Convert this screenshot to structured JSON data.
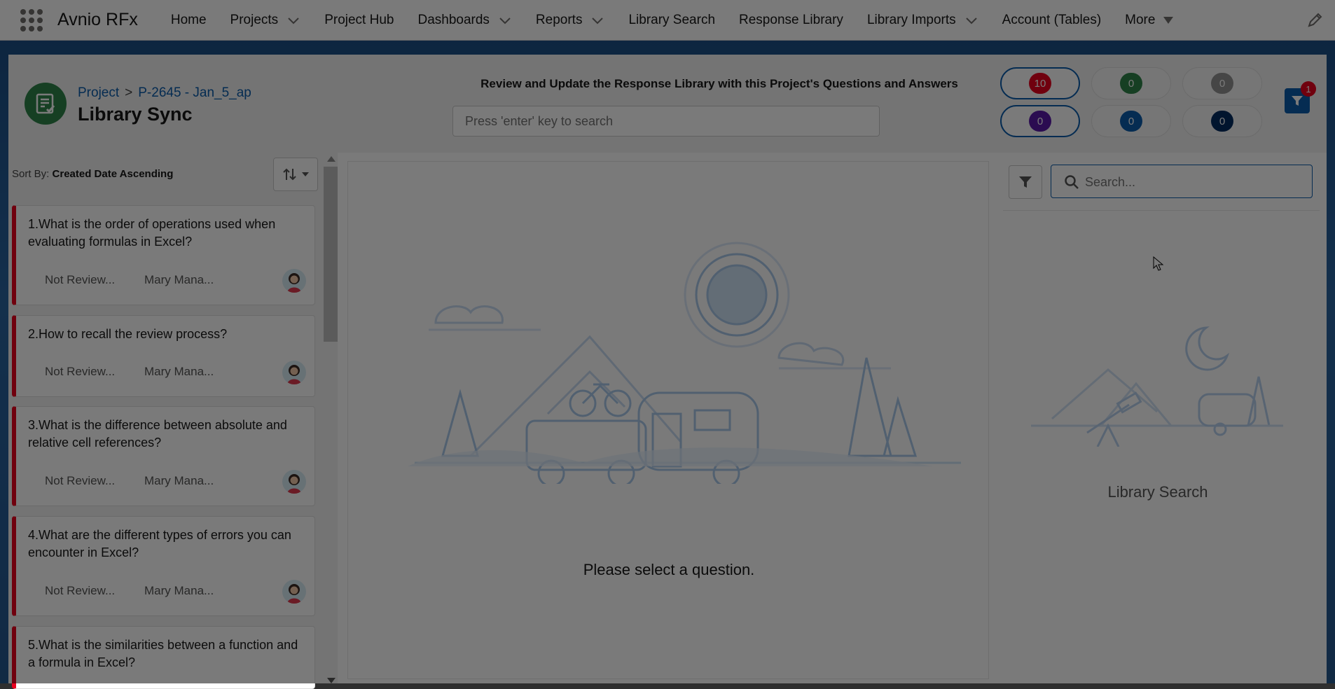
{
  "app": {
    "name": "Avnio RFx"
  },
  "nav": {
    "items": [
      {
        "label": "Home",
        "dropdown": false
      },
      {
        "label": "Projects",
        "dropdown": true
      },
      {
        "label": "Project Hub",
        "dropdown": false
      },
      {
        "label": "Dashboards",
        "dropdown": true
      },
      {
        "label": "Reports",
        "dropdown": true
      },
      {
        "label": "Library Search",
        "dropdown": false
      },
      {
        "label": "Response Library",
        "dropdown": false
      },
      {
        "label": "Library Imports",
        "dropdown": true
      },
      {
        "label": "Account (Tables)",
        "dropdown": false
      }
    ],
    "more_label": "More"
  },
  "header": {
    "breadcrumb_root": "Project",
    "breadcrumb_sep": ">",
    "breadcrumb_record": "P-2645 - Jan_5_ap",
    "title": "Library Sync",
    "instruction": "Review and Update the Response Library with this Project's Questions and Answers",
    "search_placeholder": "Press 'enter' key to search",
    "counters": [
      {
        "value": "10",
        "color": "#ea001e",
        "selected": true
      },
      {
        "value": "0",
        "color": "#2e844a",
        "selected": false
      },
      {
        "value": "0",
        "color": "#939393",
        "selected": false
      },
      {
        "value": "0",
        "color": "#5a1ba9",
        "selected": true
      },
      {
        "value": "0",
        "color": "#0b5cab",
        "selected": false
      },
      {
        "value": "0",
        "color": "#032d60",
        "selected": false
      }
    ],
    "filter_notification": "1"
  },
  "sort": {
    "prefix": "Sort By:",
    "value": "Created Date Ascending"
  },
  "questions": [
    {
      "text": "1.What is the order of operations used when evaluating formulas in Excel?",
      "status": "Not Review...",
      "owner": "Mary Mana..."
    },
    {
      "text": "2.How to recall the review process?",
      "status": "Not Review...",
      "owner": "Mary Mana..."
    },
    {
      "text": "3.What is the difference between absolute and relative cell references?",
      "status": "Not Review...",
      "owner": "Mary Mana..."
    },
    {
      "text": "4.What are the different types of errors you can encounter in Excel?",
      "status": "Not Review...",
      "owner": "Mary Mana..."
    },
    {
      "text": "5.What is the similarities between a function and a formula in Excel?",
      "status": "",
      "owner": ""
    }
  ],
  "center": {
    "empty_message": "Please select a question."
  },
  "right": {
    "search_placeholder": "Search...",
    "empty_label": "Library Search"
  },
  "colors": {
    "accent": "#0b5cab",
    "brand_green": "#2e844a",
    "status_red": "#ea001e"
  }
}
